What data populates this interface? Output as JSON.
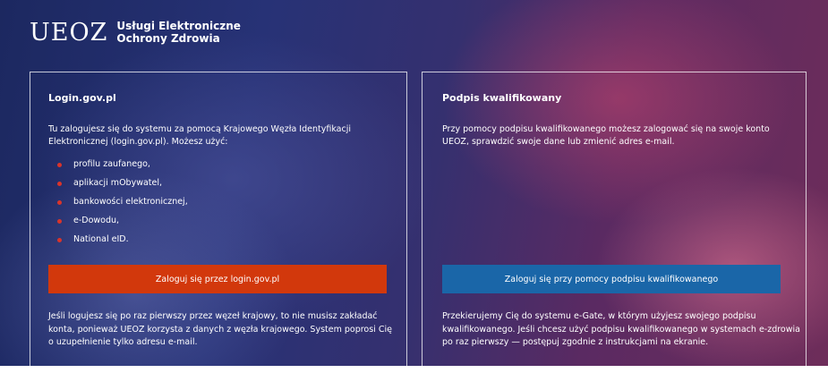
{
  "logo": {
    "mark": "UEOZ",
    "line1": "Usługi Elektroniczne",
    "line2": "Ochrony Zdrowia"
  },
  "login_gov": {
    "title": "Login.gov.pl",
    "description": "Tu zalogujesz się do systemu za pomocą Krajowego Węzła Identyfikacji Elektronicznej (login.gov.pl). Możesz użyć:",
    "options": [
      "profilu zaufanego,",
      "aplikacji mObywatel,",
      "bankowości elektronicznej,",
      "e-Dowodu,",
      "National eID."
    ],
    "button_label": "Zaloguj się przez login.gov.pl",
    "footer": "Jeśli logujesz się po raz pierwszy przez węzeł krajowy, to nie musisz zakładać konta, ponieważ UEOZ korzysta z danych z węzła krajowego. System poprosi Cię o uzupełnienie tylko adresu e-mail."
  },
  "qualified_signature": {
    "title": "Podpis kwalifikowany",
    "description": "Przy pomocy podpisu kwalifikowanego możesz zalogować się na swoje konto UEOZ, sprawdzić swoje dane lub zmienić adres e-mail.",
    "button_label": "Zaloguj się przy pomocy podpisu kwalifikowanego",
    "footer": "Przekierujemy Cię do systemu e-Gate, w którym użyjesz swojego podpisu kwalifikowanego. Jeśli chcesz użyć podpisu kwalifikowanego w systemach e-zdrowia po raz pierwszy — postępuj zgodnie z instrukcjami na ekranie."
  },
  "colors": {
    "login_button": "#d2380c",
    "signature_button": "#1a66a8",
    "bullet": "#d9342b"
  }
}
